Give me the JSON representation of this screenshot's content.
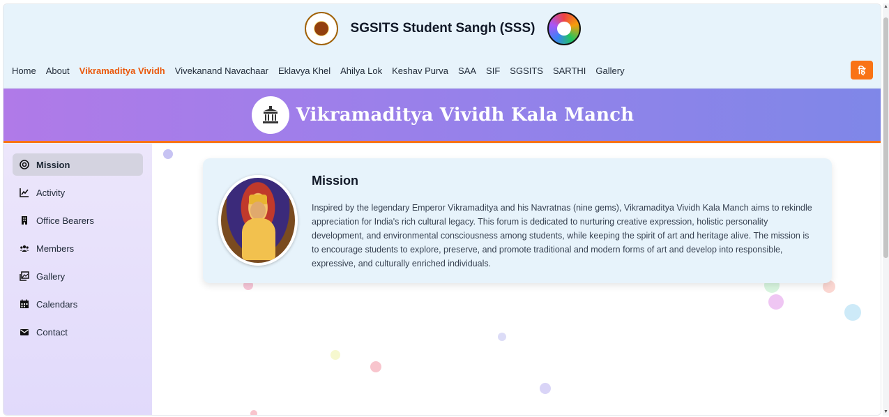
{
  "header": {
    "title": "SGSITS Student Sangh (SSS)",
    "left_logo": "sgsits-emblem-logo",
    "right_logo": "sss-colorful-logo"
  },
  "nav": {
    "items": [
      {
        "label": "Home"
      },
      {
        "label": "About"
      },
      {
        "label": "Vikramaditya Vividh",
        "active": true
      },
      {
        "label": "Vivekanand Navachaar"
      },
      {
        "label": "Eklavya Khel"
      },
      {
        "label": "Ahilya Lok"
      },
      {
        "label": "Keshav Purva"
      },
      {
        "label": "SAA"
      },
      {
        "label": "SIF"
      },
      {
        "label": "SGSITS"
      },
      {
        "label": "SARTHI"
      },
      {
        "label": "Gallery"
      }
    ],
    "language_button": "हि"
  },
  "banner": {
    "title": "Vikramaditya Vividh Kala Manch",
    "icon": "temple-icon"
  },
  "sidebar": {
    "items": [
      {
        "label": "Mission",
        "icon": "target-icon",
        "active": true
      },
      {
        "label": "Activity",
        "icon": "chart-line-icon"
      },
      {
        "label": "Office Bearers",
        "icon": "building-icon"
      },
      {
        "label": "Members",
        "icon": "users-icon"
      },
      {
        "label": "Gallery",
        "icon": "images-icon"
      },
      {
        "label": "Calendars",
        "icon": "calendar-icon"
      },
      {
        "label": "Contact",
        "icon": "envelope-icon"
      }
    ]
  },
  "mission": {
    "title": "Mission",
    "text": "Inspired by the legendary Emperor Vikramaditya and his Navratnas (nine gems), Vikramaditya Vividh Kala Manch aims to rekindle appreciation for India's rich cultural legacy. This forum is dedicated to nurturing creative expression, holistic personality development, and environmental consciousness among students, while keeping the spirit of art and heritage alive. The mission is to encourage students to explore, preserve, and promote traditional and modern forms of art and develop into responsible, expressive, and culturally enriched individuals."
  },
  "colors": {
    "accent": "#ea580c",
    "banner_start": "#b07ae8",
    "banner_end": "#7f87e8",
    "header_bg": "#e7f3fb",
    "sidebar_bg": "#e6e0fb"
  }
}
